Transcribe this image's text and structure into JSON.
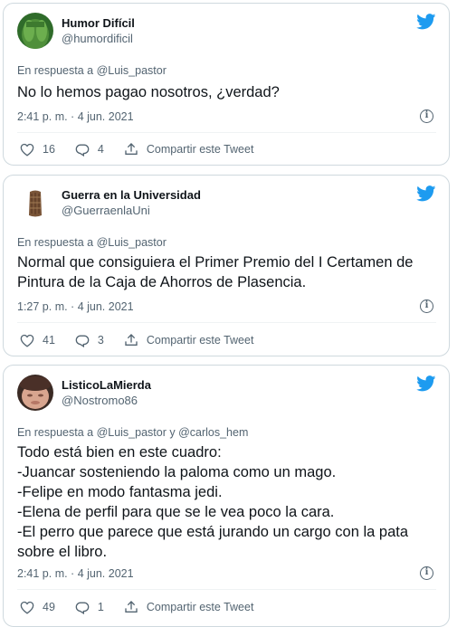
{
  "tweets": [
    {
      "display_name": "Humor Difícil",
      "handle": "@humordificil",
      "reply_prefix": "En respuesta a ",
      "reply_to": "@Luis_pastor",
      "text": "No lo hemos pagao nosotros, ¿verdad?",
      "timestamp": "2:41 p. m. · 4 jun. 2021",
      "likes": "16",
      "replies": "4",
      "share_label": "Compartir este Tweet"
    },
    {
      "display_name": "Guerra en la Universidad",
      "handle": "@GuerraenlaUni",
      "reply_prefix": "En respuesta a ",
      "reply_to": "@Luis_pastor",
      "text": "Normal que consiguiera el Primer Premio del I Certamen de Pintura de la Caja de Ahorros de Plasencia.",
      "timestamp": "1:27 p. m. · 4 jun. 2021",
      "likes": "41",
      "replies": "3",
      "share_label": "Compartir este Tweet"
    },
    {
      "display_name": "ListicoLaMierda",
      "handle": "@Nostromo86",
      "reply_prefix": "En respuesta a ",
      "reply_to": "@Luis_pastor y @carlos_hem",
      "text": "Todo está bien en este cuadro:\n-Juancar sosteniendo la paloma como un mago.\n-Felipe en modo fantasma jedi.\n-Elena de perfil para que se le vea poco la cara.\n-El perro que parece que está jurando un cargo con la pata sobre el libro.",
      "timestamp": "2:41 p. m. · 4 jun. 2021",
      "likes": "49",
      "replies": "1",
      "share_label": "Compartir este Tweet"
    }
  ],
  "colors": {
    "brand": "#1d9bf0",
    "secondary_text": "#536471",
    "border": "#cfd9de"
  },
  "icons": [
    "twitter-bird-icon",
    "heart-icon",
    "reply-icon",
    "share-icon",
    "info-icon"
  ]
}
